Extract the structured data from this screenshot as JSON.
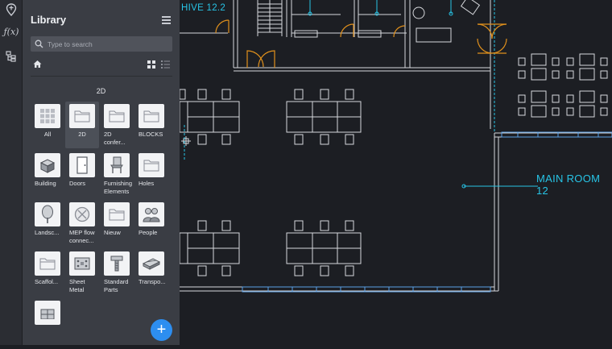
{
  "left_rail": {
    "icons": [
      "map-pin-icon",
      "function-icon",
      "tree-structure-icon"
    ],
    "function_label": "ƒ(x)"
  },
  "library": {
    "title": "Library",
    "search_placeholder": "Type to search",
    "section_title": "2D",
    "items": [
      {
        "label": "All",
        "icon": "grid-icon"
      },
      {
        "label": "2D",
        "icon": "folder-icon",
        "selected": true
      },
      {
        "label": "2D confer...",
        "icon": "folder-icon"
      },
      {
        "label": "BLOCKS",
        "icon": "folder-icon"
      },
      {
        "label": "Building",
        "icon": "building-icon"
      },
      {
        "label": "Doors",
        "icon": "door-icon"
      },
      {
        "label": "Furnishing Elements",
        "icon": "chair-icon"
      },
      {
        "label": "Holes",
        "icon": "folder-icon"
      },
      {
        "label": "Landsc...",
        "icon": "tree-icon"
      },
      {
        "label": "MEP flow connec...",
        "icon": "mep-icon"
      },
      {
        "label": "Nieuw",
        "icon": "folder-icon"
      },
      {
        "label": "People",
        "icon": "people-icon"
      },
      {
        "label": "Scaffol...",
        "icon": "folder-icon"
      },
      {
        "label": "Sheet Metal",
        "icon": "sheet-metal-icon"
      },
      {
        "label": "Standard Parts",
        "icon": "bolt-icon"
      },
      {
        "label": "Transpo...",
        "icon": "train-icon"
      },
      {
        "label": "",
        "icon": "window-icon"
      }
    ],
    "add_label": "+"
  },
  "drawing": {
    "room_labels": [
      "HIVE 12.2",
      "MAIN ROOM 12"
    ],
    "colors": {
      "background": "#1c1e23",
      "line": "#d6d8dc",
      "label": "#27c4e6",
      "door": "#e0901c",
      "window": "#5aa0e6"
    }
  }
}
